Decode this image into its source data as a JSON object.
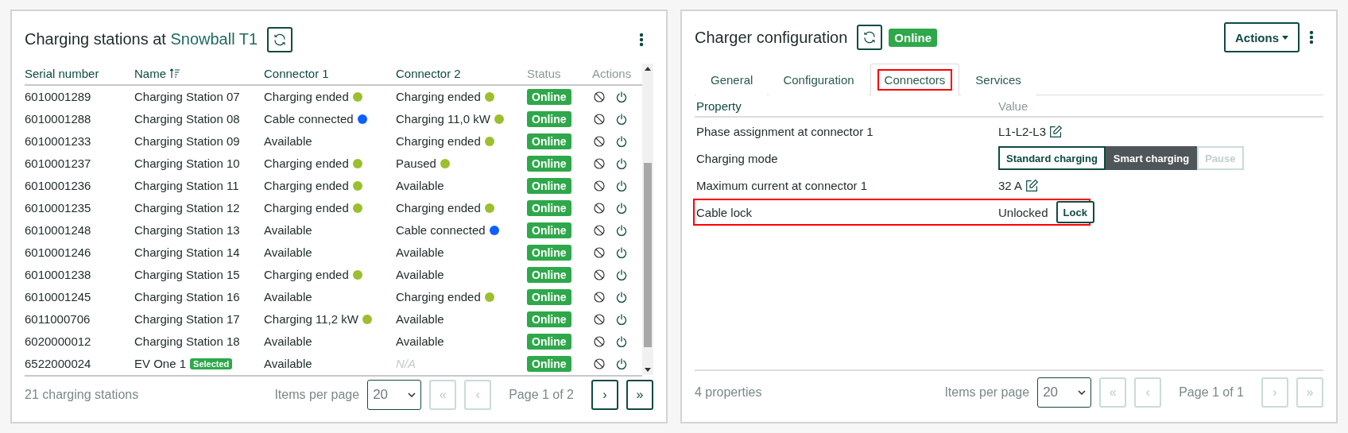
{
  "stations_panel": {
    "title_prefix": "Charging stations at",
    "site": "Snowball T1",
    "columns": [
      {
        "label": "Serial number",
        "sortable": false,
        "muted": false
      },
      {
        "label": "Name",
        "sortable": true,
        "muted": false
      },
      {
        "label": "Connector 1",
        "sortable": false,
        "muted": false
      },
      {
        "label": "Connector 2",
        "sortable": false,
        "muted": false
      },
      {
        "label": "Status",
        "sortable": false,
        "muted": true
      },
      {
        "label": "Actions",
        "sortable": false,
        "muted": true
      }
    ],
    "rows": [
      {
        "serial": "6010001289",
        "name": "Charging Station 07",
        "connector_1": {
          "text": "Charging ended",
          "color": "#9bbf2e"
        },
        "connector_2": {
          "text": "Charging ended",
          "color": "#9bbf2e"
        },
        "status": "Online"
      },
      {
        "serial": "6010001288",
        "name": "Charging Station 08",
        "connector_1": {
          "text": "Cable connected",
          "color": "#0d5fff"
        },
        "connector_2": {
          "text": "Charging 11,0 kW",
          "color": "#9bbf2e"
        },
        "status": "Online"
      },
      {
        "serial": "6010001233",
        "name": "Charging Station 09",
        "connector_1": {
          "text": "Available"
        },
        "connector_2": {
          "text": "Charging ended",
          "color": "#9bbf2e"
        },
        "status": "Online"
      },
      {
        "serial": "6010001237",
        "name": "Charging Station 10",
        "connector_1": {
          "text": "Charging ended",
          "color": "#9bbf2e"
        },
        "connector_2": {
          "text": "Paused",
          "color": "#9bbf2e"
        },
        "status": "Online"
      },
      {
        "serial": "6010001236",
        "name": "Charging Station 11",
        "connector_1": {
          "text": "Charging ended",
          "color": "#9bbf2e"
        },
        "connector_2": {
          "text": "Available"
        },
        "status": "Online"
      },
      {
        "serial": "6010001235",
        "name": "Charging Station 12",
        "connector_1": {
          "text": "Charging ended",
          "color": "#9bbf2e"
        },
        "connector_2": {
          "text": "Charging ended",
          "color": "#9bbf2e"
        },
        "status": "Online"
      },
      {
        "serial": "6010001248",
        "name": "Charging Station 13",
        "connector_1": {
          "text": "Available"
        },
        "connector_2": {
          "text": "Cable connected",
          "color": "#0d5fff"
        },
        "status": "Online"
      },
      {
        "serial": "6010001246",
        "name": "Charging Station 14",
        "connector_1": {
          "text": "Available"
        },
        "connector_2": {
          "text": "Available"
        },
        "status": "Online"
      },
      {
        "serial": "6010001238",
        "name": "Charging Station 15",
        "connector_1": {
          "text": "Charging ended",
          "color": "#9bbf2e"
        },
        "connector_2": {
          "text": "Available"
        },
        "status": "Online"
      },
      {
        "serial": "6010001245",
        "name": "Charging Station 16",
        "connector_1": {
          "text": "Available"
        },
        "connector_2": {
          "text": "Charging ended",
          "color": "#9bbf2e"
        },
        "status": "Online"
      },
      {
        "serial": "6011000706",
        "name": "Charging Station 17",
        "connector_1": {
          "text": "Charging 11,2 kW",
          "color": "#9bbf2e"
        },
        "connector_2": {
          "text": "Available"
        },
        "status": "Online"
      },
      {
        "serial": "6020000012",
        "name": "Charging Station 18",
        "connector_1": {
          "text": "Available"
        },
        "connector_2": {
          "text": "Available"
        },
        "status": "Online"
      },
      {
        "serial": "6522000024",
        "name": "EV One 1",
        "badge": "Selected",
        "connector_1": {
          "text": "Available"
        },
        "connector_2": {
          "text": "N/A",
          "missing": true
        },
        "status": "Online"
      }
    ],
    "footer": {
      "count": "21 charging stations",
      "items_label": "Items per page",
      "page_size": "20",
      "page_info": "Page 1 of 2",
      "nav": [
        {
          "label": "«",
          "disabled": true
        },
        {
          "label": "‹",
          "disabled": true
        },
        {
          "label": "›",
          "disabled": false
        },
        {
          "label": "»",
          "disabled": false
        }
      ]
    }
  },
  "config_panel": {
    "title": "Charger configuration",
    "status": "Online",
    "actions_button": "Actions",
    "tabs": [
      {
        "label": "General",
        "selected": false,
        "highlighted": false
      },
      {
        "label": "Configuration",
        "selected": false,
        "highlighted": false
      },
      {
        "label": "Connectors",
        "selected": true,
        "highlighted": true
      },
      {
        "label": "Services",
        "selected": false,
        "highlighted": false
      }
    ],
    "columns": [
      "Property",
      "Value"
    ],
    "properties": [
      {
        "kind": "editable",
        "name": "Phase assignment at connector 1",
        "value": "L1-L2-L3",
        "highlighted": false
      },
      {
        "kind": "segmented",
        "name": "Charging mode",
        "options": [
          {
            "label": "Standard charging",
            "selected": false,
            "disabled": false
          },
          {
            "label": "Smart charging",
            "selected": true,
            "disabled": false
          },
          {
            "label": "Pause",
            "selected": false,
            "disabled": true
          }
        ],
        "highlighted": false
      },
      {
        "kind": "editable",
        "name": "Maximum current at connector 1",
        "value": "32 A",
        "highlighted": false
      },
      {
        "kind": "action",
        "name": "Cable lock",
        "value": "Unlocked",
        "button": "Lock",
        "highlighted": true
      }
    ],
    "footer": {
      "count": "4 properties",
      "items_label": "Items per page",
      "page_size": "20",
      "page_info": "Page 1 of 1",
      "nav": [
        {
          "label": "«",
          "disabled": true
        },
        {
          "label": "‹",
          "disabled": true
        },
        {
          "label": "›",
          "disabled": true
        },
        {
          "label": "»",
          "disabled": true
        }
      ]
    }
  }
}
